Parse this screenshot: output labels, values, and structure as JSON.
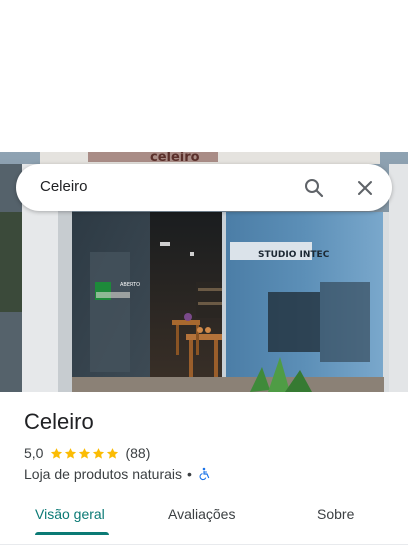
{
  "search": {
    "query": "Celeiro",
    "search_icon": "search-icon",
    "close_icon": "close-icon"
  },
  "hero": {
    "sign_text": "celeiro",
    "store_text": "STUDIO INTEC",
    "door_label": "ABERTO"
  },
  "place": {
    "name": "Celeiro",
    "rating": "5,0",
    "stars": 5,
    "reviews": "(88)",
    "category": "Loja de produtos naturais",
    "separator": "•",
    "accessibility_icon": "wheelchair-icon"
  },
  "tabs": [
    {
      "label": "Visão geral",
      "active": true
    },
    {
      "label": "Avaliações",
      "active": false
    },
    {
      "label": "Sobre",
      "active": false
    }
  ],
  "colors": {
    "accent": "#0b7a75",
    "star": "#fbbc04",
    "accessibility": "#1a73e8"
  }
}
